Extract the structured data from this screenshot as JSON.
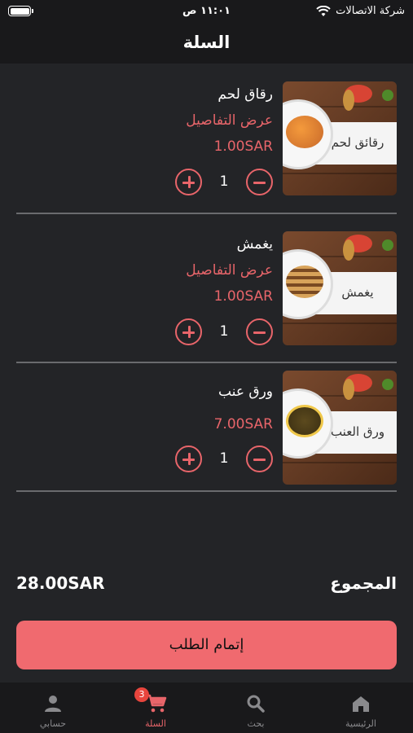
{
  "status_bar": {
    "carrier": "شركة الاتصالات",
    "time": "١١:٠١ ص"
  },
  "header": {
    "title": "السلة"
  },
  "cart_items": [
    {
      "name": "رقاق لحم",
      "details_link": "عرض التفاصيل",
      "price": "1.00SAR",
      "quantity": "1",
      "image_caption": "رقائق لحم"
    },
    {
      "name": "يغمش",
      "details_link": "عرض التفاصيل",
      "price": "1.00SAR",
      "quantity": "1",
      "image_caption": "يغمش"
    },
    {
      "name": "ورق عنب",
      "price": "7.00SAR",
      "quantity": "1",
      "image_caption": "ورق العنب"
    }
  ],
  "summary": {
    "total_label": "المجموع",
    "total_value": "28.00SAR"
  },
  "checkout_button": "إتمام الطلب",
  "tabs": [
    {
      "label": "الرئيسية",
      "icon": "home-icon"
    },
    {
      "label": "بحث",
      "icon": "search-icon"
    },
    {
      "label": "السلة",
      "icon": "cart-icon",
      "badge": "3",
      "active": true
    },
    {
      "label": "حسابي",
      "icon": "person-icon"
    }
  ],
  "colors": {
    "accent": "#e8656a",
    "button": "#f06a6f",
    "background": "#232427",
    "bar": "#19191b"
  }
}
